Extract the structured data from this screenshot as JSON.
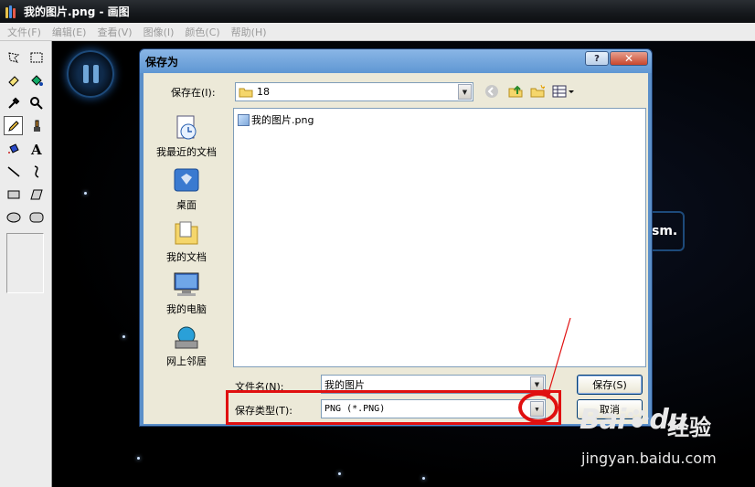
{
  "window": {
    "title": "我的图片.png - 画图",
    "menu": [
      "文件(F)",
      "编辑(E)",
      "查看(V)",
      "图像(I)",
      "颜色(C)",
      "帮助(H)"
    ]
  },
  "canvas_text": "sm.",
  "dialog": {
    "title": "保存为",
    "help_btn": "?",
    "close_btn": "✕",
    "save_in_label": "保存在(I):",
    "save_in_value": "18",
    "places": [
      "我最近的文档",
      "桌面",
      "我的文档",
      "我的电脑",
      "网上邻居"
    ],
    "files": [
      "我的图片.png"
    ],
    "filename_label": "文件名(N):",
    "filename_value": "我的图片",
    "filetype_label": "保存类型(T):",
    "filetype_value": "PNG (*.PNG)",
    "save_button": "保存(S)",
    "cancel_button": "取消"
  },
  "watermark": {
    "brand": "Bai",
    "brand2": "du",
    "cn": "经验",
    "url": "jingyan.baidu.com"
  },
  "colors": {
    "annotation": "#e01010",
    "dialog_frame": "#5b8fc9"
  }
}
